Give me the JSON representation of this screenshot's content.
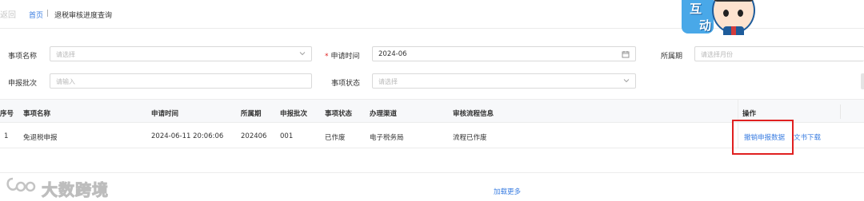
{
  "header": {
    "back_label": "返回",
    "breadcrumb_home": "首页",
    "breadcrumb_sep": "|",
    "breadcrumb_current": "退税审核进度查询"
  },
  "mascot": {
    "text_1": "互",
    "text_2": "动"
  },
  "form": {
    "item_name": {
      "label": "事项名称",
      "placeholder": "请选择"
    },
    "apply_time": {
      "label": "申请时间",
      "required_mark": "*",
      "value": "2024-06"
    },
    "period": {
      "label": "所属期",
      "placeholder": "请选择月份"
    },
    "batch": {
      "label": "申报批次",
      "placeholder": "请输入"
    },
    "status": {
      "label": "事项状态",
      "placeholder": "请选择"
    }
  },
  "table": {
    "headers": {
      "seq": "序号",
      "name": "事项名称",
      "apply_time": "申请时间",
      "period": "所属期",
      "batch": "申报批次",
      "status": "事项状态",
      "channel": "办理渠道",
      "review": "审核流程信息",
      "ops": "操作"
    },
    "rows": [
      {
        "seq": "1",
        "name": "免退税申报",
        "apply_time": "2024-06-11 20:06:06",
        "period": "202406",
        "batch": "001",
        "status": "已作废",
        "channel": "电子税务局",
        "review": "流程已作废",
        "action_revoke": "撤销申报数据",
        "action_doc": "文书下载"
      }
    ]
  },
  "load_more": "加载更多",
  "watermark": {
    "text": "大数跨境"
  },
  "colors": {
    "link": "#3a7de1",
    "required": "#e02020",
    "highlight_box": "#e02020"
  }
}
